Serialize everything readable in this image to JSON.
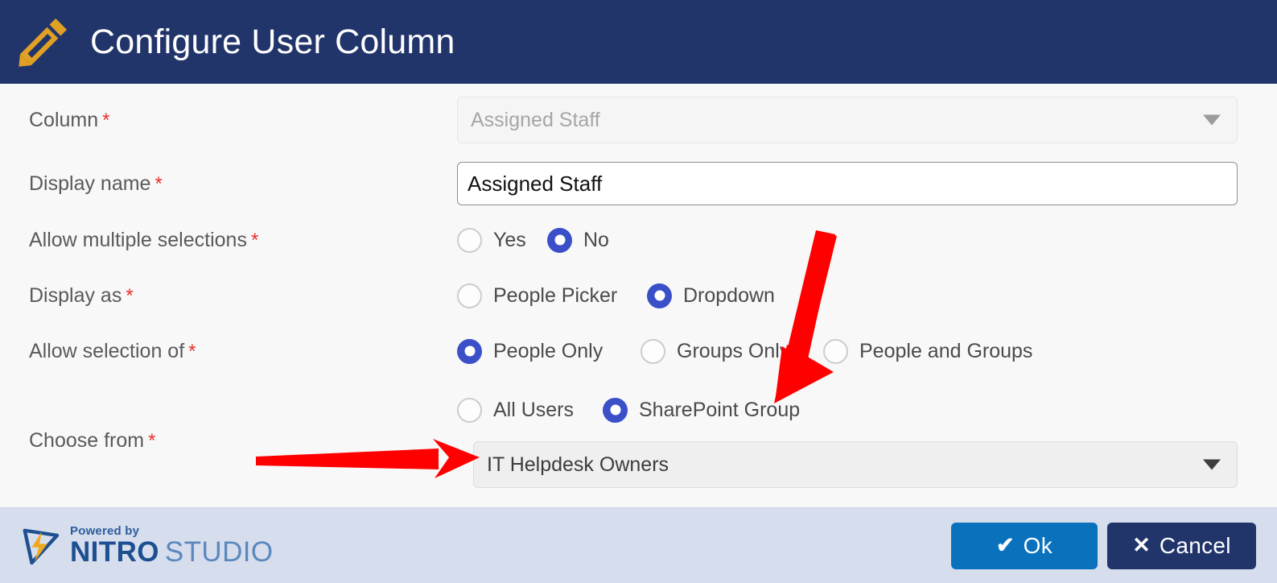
{
  "header": {
    "title": "Configure User Column",
    "icon": "pencil-icon",
    "background_color": "#22356B",
    "icon_color": "#E0A024"
  },
  "form": {
    "rows": [
      {
        "label": "Column",
        "required_marker": "*",
        "control": "select-disabled",
        "value": "Assigned Staff"
      },
      {
        "label": "Display name",
        "required_marker": "*",
        "control": "text-input",
        "value": "Assigned Staff"
      },
      {
        "label": "Allow multiple selections",
        "required_marker": "*",
        "control": "radio-group",
        "options": [
          {
            "label": "Yes",
            "selected": false
          },
          {
            "label": "No",
            "selected": true
          }
        ]
      },
      {
        "label": "Display as",
        "required_marker": "*",
        "control": "radio-group",
        "options": [
          {
            "label": "People Picker",
            "selected": false
          },
          {
            "label": "Dropdown",
            "selected": true
          }
        ]
      },
      {
        "label": "Allow selection of",
        "required_marker": "*",
        "control": "radio-group",
        "options": [
          {
            "label": "People Only",
            "selected": true
          },
          {
            "label": "Groups Only",
            "selected": false
          },
          {
            "label": "People and Groups",
            "selected": false
          }
        ]
      },
      {
        "label": "Choose from",
        "required_marker": "*",
        "control": "radio-group-and-select",
        "options": [
          {
            "label": "All Users",
            "selected": false
          },
          {
            "label": "SharePoint Group",
            "selected": true
          }
        ],
        "value": "IT Helpdesk Owners"
      }
    ],
    "accent_selected_color": "#3B50C8",
    "required_color": "#E8302A"
  },
  "footer": {
    "logo": {
      "powered_by": "Powered by",
      "brand_primary": "NITRO",
      "brand_secondary": "STUDIO",
      "mark": "nitro-lightning-logo"
    },
    "buttons": [
      {
        "name": "ok",
        "label": "Ok",
        "glyph": "✔",
        "color": "#0A72BD"
      },
      {
        "name": "cancel",
        "label": "Cancel",
        "glyph": "✕",
        "color": "#22356B"
      }
    ],
    "background_color": "#D6DDED"
  },
  "annotations": [
    {
      "name": "arrow-to-sharepoint-group",
      "type": "arrow-diagonal-down-left",
      "color": "#FF0000",
      "points_at": "SharePoint Group"
    },
    {
      "name": "arrow-to-group-dropdown",
      "type": "arrow-horizontal-right",
      "color": "#FF0000",
      "points_at": "IT Helpdesk Owners"
    }
  ]
}
